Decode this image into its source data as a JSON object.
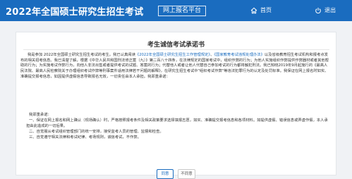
{
  "header": {
    "title": "2022年全国硕士研究生招生考试",
    "badge": "网上报名平台",
    "home_label": "首页",
    "exit_label": "退出",
    "bg_color": "#1a6cbf",
    "home_icon": "home-icon",
    "exit_icon": "power-icon"
  },
  "document": {
    "title": "考生诚信考试承诺书",
    "p_lead": "我是参加 2022年全国硕士研究生招生考试的考生。我已认真阅读",
    "link_1": "《2022年全国硕士研究生招生工作管理规定》",
    "p_mid": "、",
    "link_2": "《国家教育考试违规处理办法》",
    "p_body": "以及省级教育招生考试机构和报考点发布的相关招考信息。我已清楚了解，根据《中华人民共和国刑法修正案（九）》第二百八十四条，在法律规定的国家考试中，组织作弊的行为；为他人实施组织作弊提供作弊器材或者其他帮助的行为；为实施考试作弊行为，向他人非法出售或者提供考试的试题、答案的行为；代替他人或者让他人代替自己参加考试的行为都将触犯刑法。我已知晓2019年9月起施行的《最高人民法院、最高人民检察院关于办理组织考试作弊等刑事案件适用法律若干问题的解释》，在研究生招生考试中\"组织考试作弊\"等违法犯罪行为的认定及处罚标准。我保证在网上报名时如实、准确提交报考信息，如因提供虚假信息导致报名无效，一切责任由本人承担。我郑重承诺：",
    "req_head": "我郑重承诺：",
    "requirements": [
      "一、保证在网上报名和网上确认（现场确认）时，严格按照报考条件及相关政策要求选择填报志愿，如实、准确提交报考信息和各项材料。如提供虚假、错误信息或弄虚作假，本人承担由此造成的一切后果。",
      "二、自觉服从考试组织管理部门的统一安排，接受监考人员的管理、监督和检查。",
      "三、自觉遵守相关法律和考试纪律、考场规则，诚信考试，不作弊。"
    ]
  },
  "buttons": {
    "agree": "同意",
    "disagree": "不同意"
  }
}
